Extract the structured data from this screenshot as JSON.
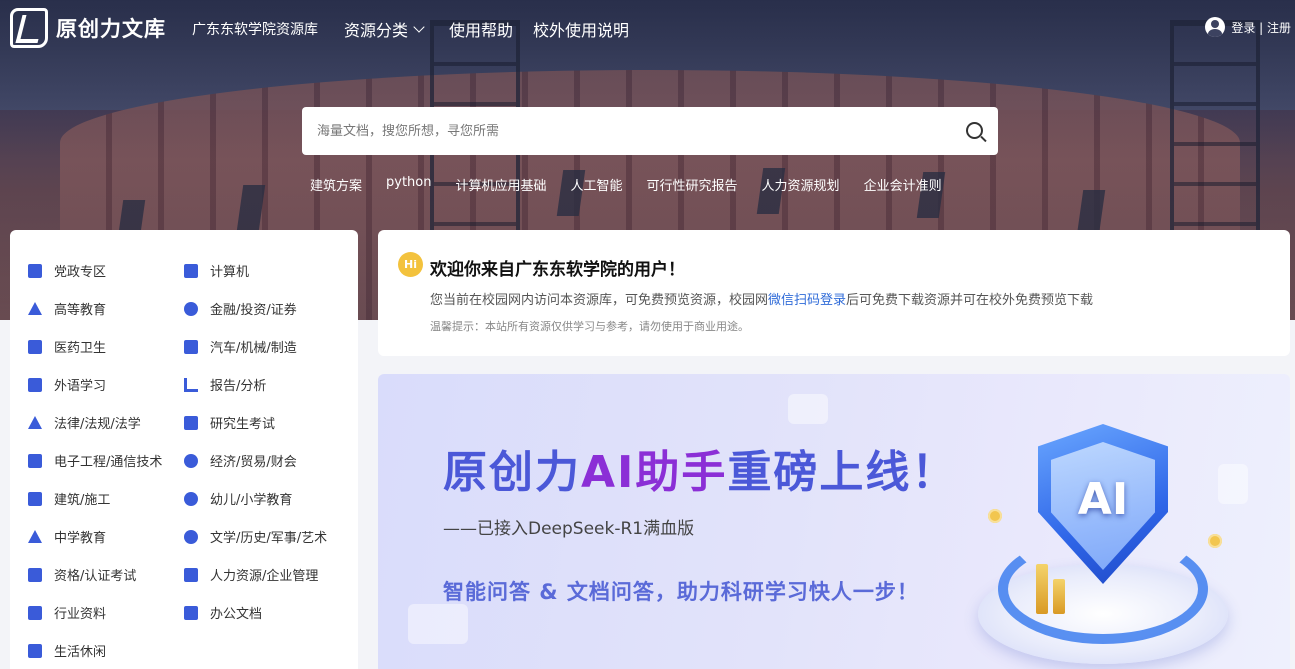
{
  "brand": {
    "logo_text": "原创力文库",
    "school": "广东东软学院资源库"
  },
  "nav": {
    "items": [
      {
        "label": "资源分类",
        "has_dropdown": true
      },
      {
        "label": "使用帮助"
      },
      {
        "label": "校外使用说明"
      }
    ],
    "auth": "登录 | 注册"
  },
  "search": {
    "placeholder": "海量文档，搜您所想，寻您所需"
  },
  "hot_words": [
    "建筑方案",
    "python",
    "计算机应用基础",
    "人工智能",
    "可行性研究报告",
    "人力资源规划",
    "企业会计准则"
  ],
  "categories": {
    "left": [
      "党政专区",
      "高等教育",
      "医药卫生",
      "外语学习",
      "法律/法规/法学",
      "电子工程/通信技术",
      "建筑/施工",
      "中学教育",
      "资格/认证考试",
      "行业资料",
      "生活休闲"
    ],
    "right": [
      "计算机",
      "金融/投资/证券",
      "汽车/机械/制造",
      "报告/分析",
      "研究生考试",
      "经济/贸易/财会",
      "幼儿/小学教育",
      "文学/历史/军事/艺术",
      "人力资源/企业管理",
      "办公文档"
    ]
  },
  "welcome": {
    "badge": "Hi",
    "title": "欢迎你来自广东东软学院的用户！",
    "desc_prefix": "您当前在校园网内访问本资源库，可免费预览资源，校园网",
    "desc_link": "微信扫码登录",
    "desc_suffix": "后可免费下载资源并可在校外免费预览下载",
    "tip": "温馨提示：本站所有资源仅供学习与参考，请勿使用于商业用途。"
  },
  "banner": {
    "title_part1": "原创力",
    "title_part2": "AI助手",
    "title_part3": "重磅上线！",
    "subtitle": "——已接入DeepSeek-R1满血版",
    "slogan": "智能问答 & 文档问答，助力科研学习快人一步！",
    "shield_text": "AI"
  },
  "colors": {
    "accent": "#3a5bd9",
    "link": "#2f6bd8",
    "banner_blue": "#4b58d8",
    "banner_purple": "#8b2fd6"
  }
}
